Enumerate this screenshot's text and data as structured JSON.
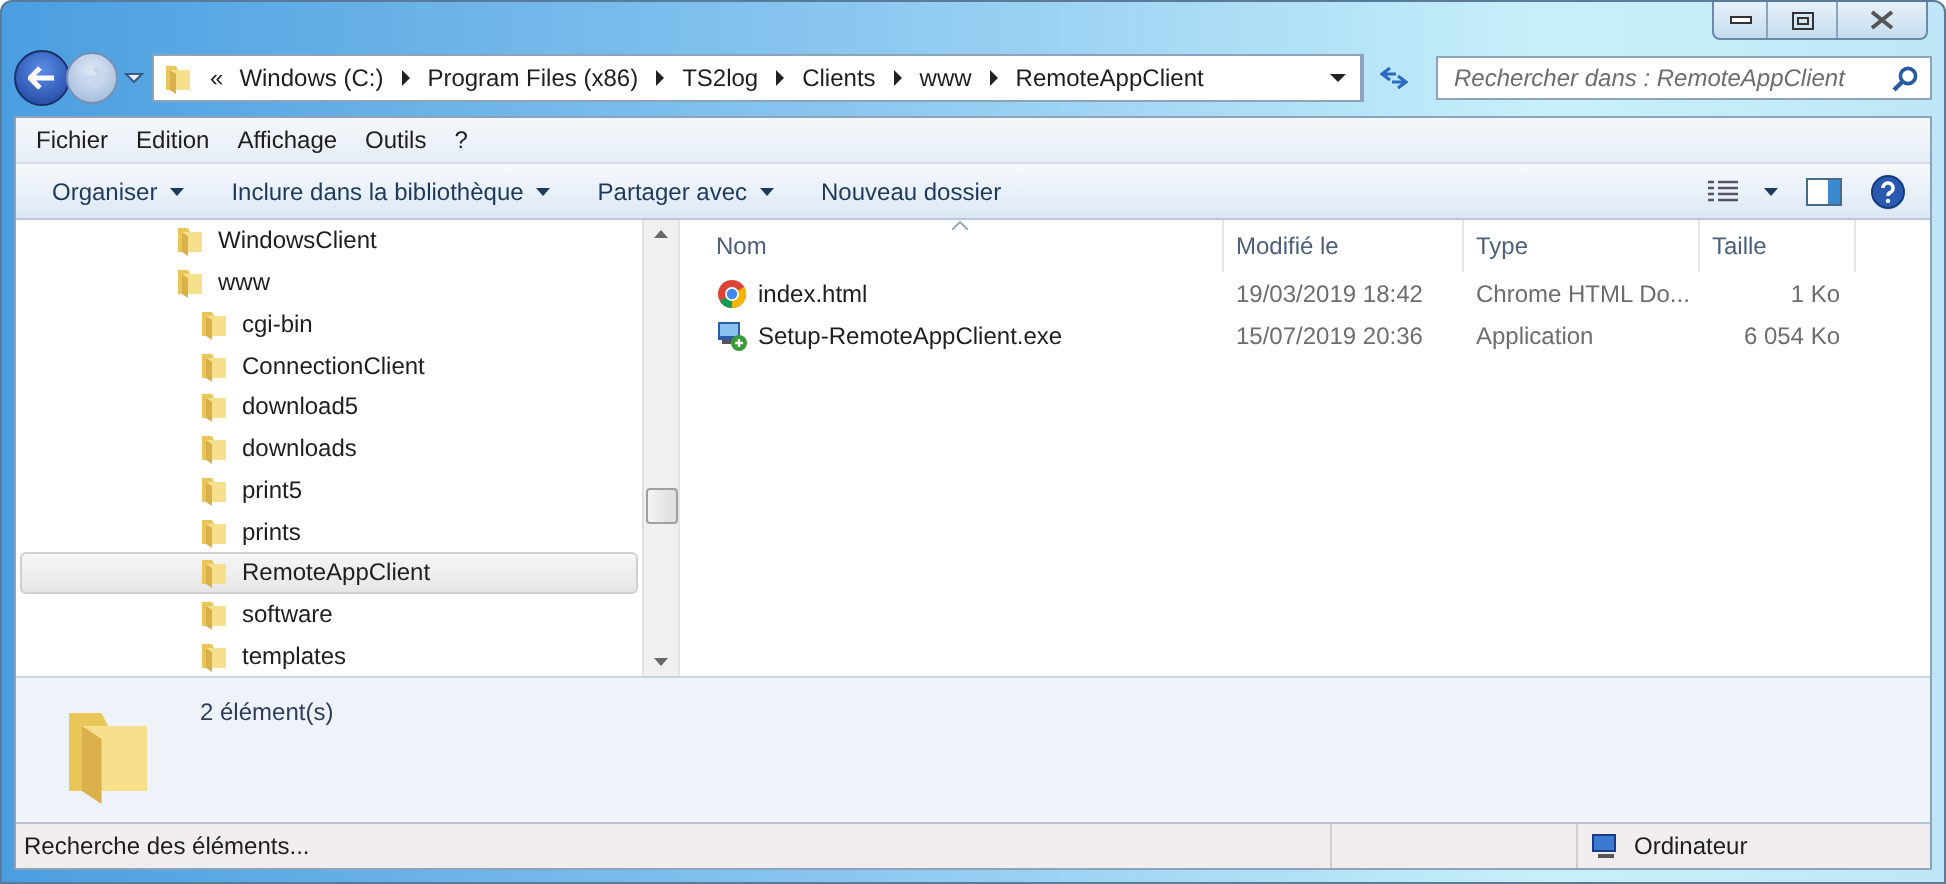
{
  "address_bar": {
    "overflow": "«",
    "crumbs": [
      "Windows  (C:)",
      "Program Files (x86)",
      "TS2log",
      "Clients",
      "www",
      "RemoteAppClient"
    ]
  },
  "search": {
    "placeholder": "Rechercher dans : RemoteAppClient"
  },
  "menu_bar": [
    "Fichier",
    "Edition",
    "Affichage",
    "Outils",
    "?"
  ],
  "command_bar": [
    {
      "label": "Organiser",
      "dropdown": true
    },
    {
      "label": "Inclure dans la bibliothèque",
      "dropdown": true
    },
    {
      "label": "Partager avec",
      "dropdown": true
    },
    {
      "label": "Nouveau dossier",
      "dropdown": false
    }
  ],
  "nav_tree": [
    {
      "label": "WindowsClient",
      "selected": false
    },
    {
      "label": "www",
      "selected": false,
      "children": [
        {
          "label": "cgi-bin",
          "selected": false
        },
        {
          "label": "ConnectionClient",
          "selected": false
        },
        {
          "label": "download5",
          "selected": false
        },
        {
          "label": "downloads",
          "selected": false
        },
        {
          "label": "print5",
          "selected": false
        },
        {
          "label": "prints",
          "selected": false
        },
        {
          "label": "RemoteAppClient",
          "selected": true
        },
        {
          "label": "software",
          "selected": false
        },
        {
          "label": "templates",
          "selected": false
        }
      ]
    }
  ],
  "file_list": {
    "columns": [
      "Nom",
      "Modifié le",
      "Type",
      "Taille"
    ],
    "rows": [
      {
        "kind": "html",
        "name": "index.html",
        "modified": "19/03/2019 18:42",
        "type": "Chrome HTML Do...",
        "size": "1 Ko"
      },
      {
        "kind": "exe",
        "name": "Setup-RemoteAppClient.exe",
        "modified": "15/07/2019 20:36",
        "type": "Application",
        "size": "6 054 Ko"
      }
    ]
  },
  "details_pane": {
    "count": "2 élément(s)"
  },
  "status_bar": {
    "message": "Recherche des éléments...",
    "location": "Ordinateur"
  }
}
